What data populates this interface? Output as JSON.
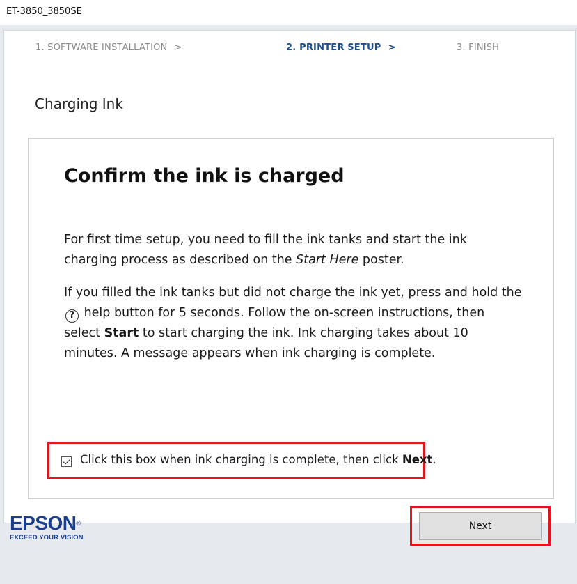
{
  "window": {
    "title": "ET-3850_3850SE"
  },
  "steps": [
    {
      "label": "1. SOFTWARE INSTALLATION",
      "chevron": ">"
    },
    {
      "label": "2. PRINTER SETUP",
      "chevron": ">"
    },
    {
      "label": "3. FINISH"
    }
  ],
  "section_title": "Charging Ink",
  "card": {
    "heading": "Confirm the ink is charged",
    "para1": {
      "before": "For first time setup, you need to fill the ink tanks and start the ink charging process as described on the ",
      "italic": "Start Here",
      "after": " poster."
    },
    "para2": {
      "part1": "If you filled the ink tanks but did not charge the ink yet, press and hold the ",
      "help_glyph": "?",
      "part2": " help button for 5 seconds. Follow the on-screen instructions, then select ",
      "bold": "Start",
      "part3": " to start charging the ink. Ink charging takes about 10 minutes. A message appears when ink charging is complete."
    },
    "confirm": {
      "checked": true,
      "before": "Click this box when ink charging is complete, then click ",
      "bold": "Next",
      "after": "."
    }
  },
  "footer": {
    "logo": {
      "wordmark": "EPSON",
      "reg": "®",
      "tagline": "EXCEED YOUR VISION"
    },
    "next_label": "Next"
  },
  "colors": {
    "accent_blue": "#1d4f8c",
    "highlight_red": "#e3151c",
    "brand_blue": "#1a3d8f"
  }
}
